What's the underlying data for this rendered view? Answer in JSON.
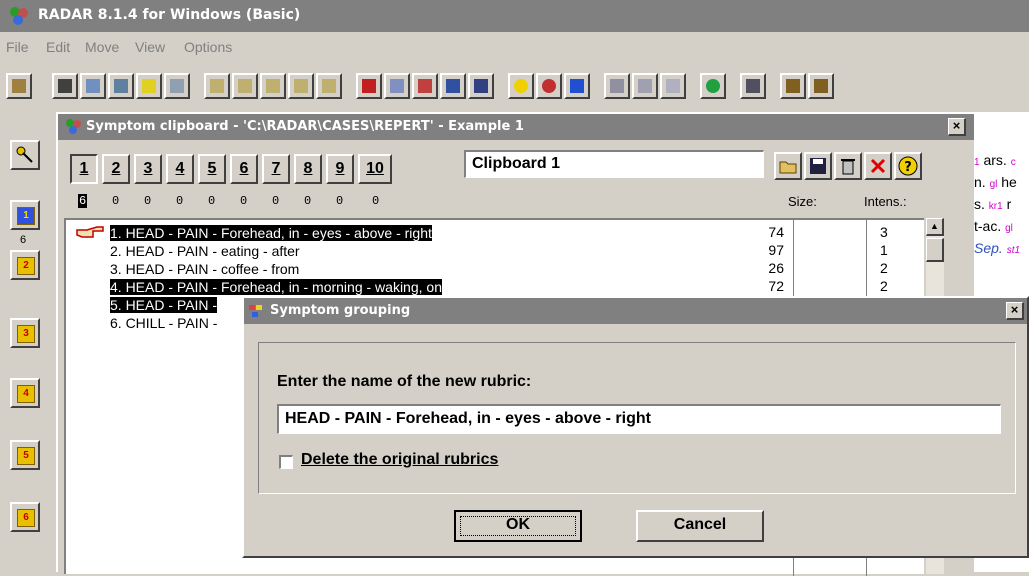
{
  "app": {
    "title": "RADAR 8.1.4 for Windows (Basic)"
  },
  "menu": [
    "File",
    "Edit",
    "Move",
    "View",
    "Options"
  ],
  "left_panel": {
    "buttons": [
      "1",
      "2",
      "3",
      "4",
      "5",
      "6"
    ],
    "active_count": "6"
  },
  "clipboard": {
    "title": "Symptom clipboard - 'C:\\RADAR\\CASES\\REPERT' - Example 1",
    "tabs": [
      "1",
      "2",
      "3",
      "4",
      "5",
      "6",
      "7",
      "8",
      "9",
      "10"
    ],
    "counts": [
      "6",
      "0",
      "0",
      "0",
      "0",
      "0",
      "0",
      "0",
      "0",
      "0"
    ],
    "name": "Clipboard 1",
    "col_size": "Size:",
    "col_intens": "Intens.:",
    "rows": [
      {
        "text": "1. HEAD - PAIN - Forehead, in - eyes - above - right",
        "size": "74",
        "intens": "3",
        "selected": true
      },
      {
        "text": "2. HEAD - PAIN - eating - after",
        "size": "97",
        "intens": "1",
        "selected": false
      },
      {
        "text": "3. HEAD - PAIN - coffee - from",
        "size": "26",
        "intens": "2",
        "selected": false
      },
      {
        "text": "4. HEAD - PAIN - Forehead, in - morning - waking, on",
        "size": "72",
        "intens": "2",
        "selected": true
      },
      {
        "text": "5. HEAD - PAIN -",
        "size": "",
        "intens": "",
        "selected": true
      },
      {
        "text": "6. CHILL - PAIN -",
        "size": "",
        "intens": "",
        "selected": false
      }
    ]
  },
  "right_pane": [
    {
      "pre": "1",
      "main": " ars.",
      "sub": "c"
    },
    {
      "pre": "",
      "main": "n.",
      "sub": "gl",
      "post": " he"
    },
    {
      "pre": "",
      "main": "s.",
      "sub": "kr1",
      "post": " r"
    },
    {
      "pre": "",
      "main": "t-ac.",
      "sub": "gl",
      "post": ""
    },
    {
      "pre": "",
      "main": "Sep.",
      "sub": "st1",
      "post": ""
    }
  ],
  "dialog": {
    "title": "Symptom grouping",
    "prompt": "Enter the name of the new rubric:",
    "value": "HEAD - PAIN - Forehead, in - eyes - above - right",
    "checkbox_label": "Delete the original rubrics",
    "ok": "OK",
    "cancel": "Cancel"
  }
}
